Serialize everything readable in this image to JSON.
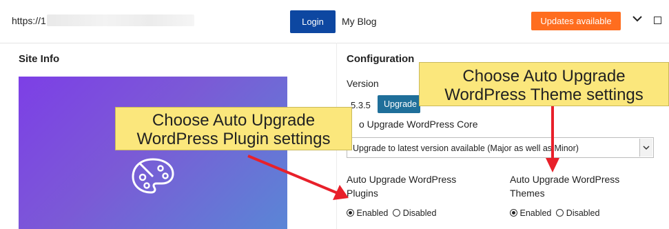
{
  "topbar": {
    "url": "https://1",
    "login_label": "Login",
    "site_name": "My Blog",
    "updates_label": "Updates available"
  },
  "site_info": {
    "heading": "Site Info"
  },
  "configuration": {
    "heading": "Configuration",
    "version_label": "Version",
    "version_value": "5.3.5",
    "upgrade_label": "Upgrade",
    "core_label": "o Upgrade WordPress Core",
    "core_select_value": "Upgrade to latest version available (Major as well as Minor)",
    "plugins_label_line1": "Auto Upgrade WordPress",
    "plugins_label_line2": "Plugins",
    "themes_label_line1": "Auto Upgrade WordPress",
    "themes_label_line2": "Themes",
    "enabled_label": "Enabled",
    "disabled_label": "Disabled",
    "plugins_selected": "Enabled",
    "themes_selected": "Enabled"
  },
  "callouts": {
    "plugin_line1": "Choose Auto Upgrade",
    "plugin_line2": "WordPress Plugin settings",
    "theme_line1": "Choose Auto Upgrade",
    "theme_line2": "WordPress Theme settings"
  },
  "icons": {
    "palette": "palette-icon",
    "chevron": "chevron-down-icon",
    "maximize": "maximize-icon"
  },
  "colors": {
    "login_button": "#0d47a1",
    "updates_button": "#ff6d1f",
    "upgrade_button": "#1f6f9a",
    "callout": "#fbe77c",
    "arrow": "#e8202a"
  }
}
